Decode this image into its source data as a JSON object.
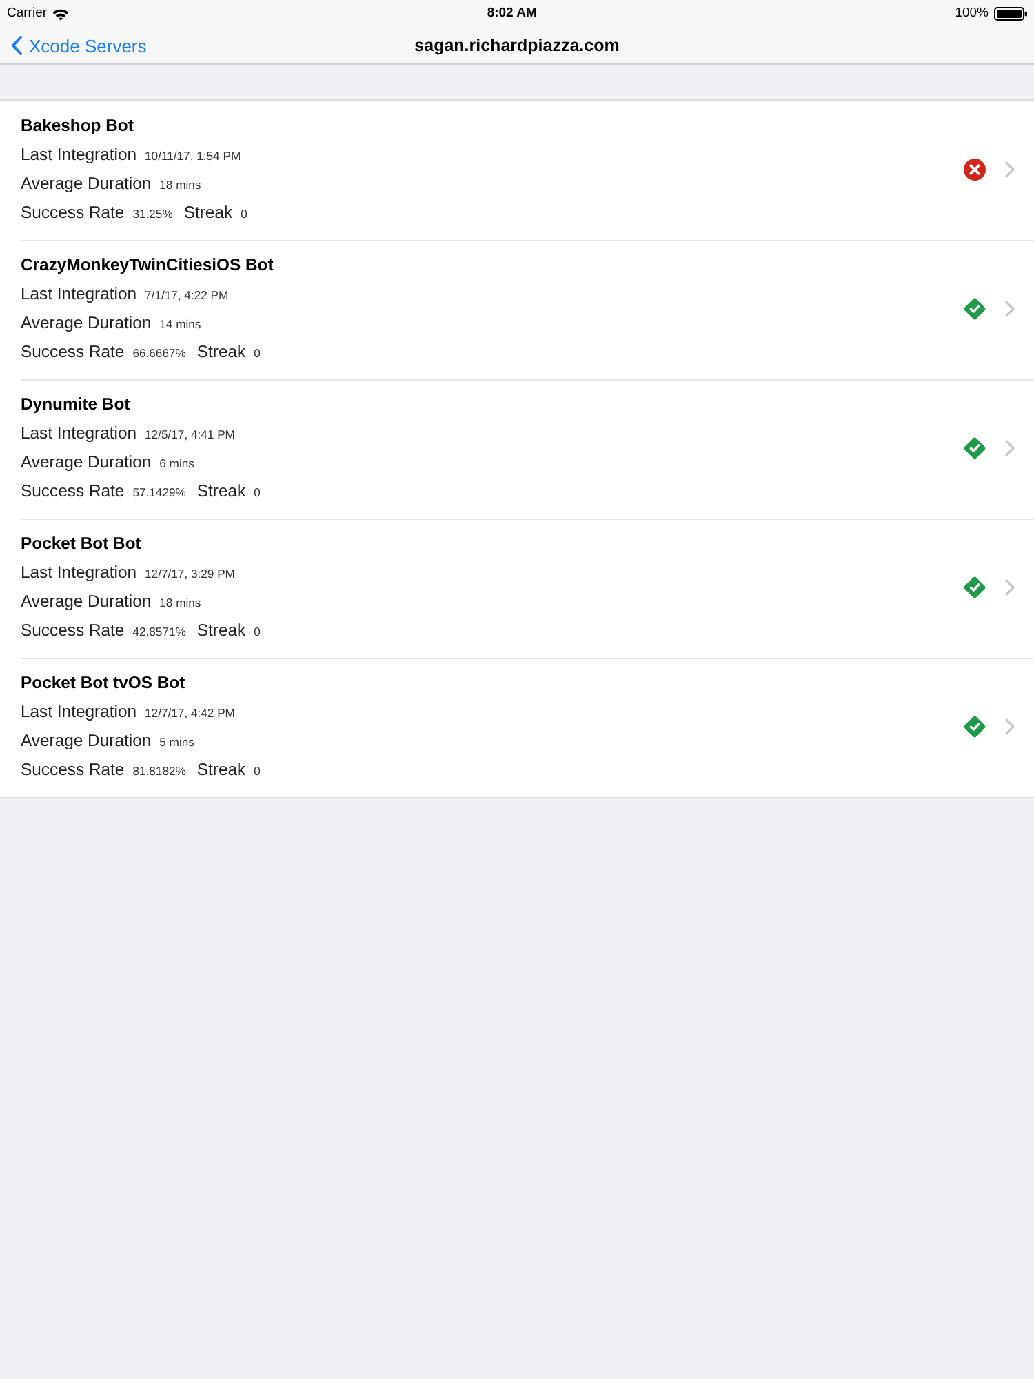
{
  "status_bar": {
    "carrier": "Carrier",
    "time": "8:02 AM",
    "battery": "100%"
  },
  "nav_bar": {
    "back": "Xcode Servers",
    "title": "sagan.richardpiazza.com"
  },
  "bots": [
    {
      "name": "Bakeshop Bot",
      "passed": false,
      "lines": [
        [
          {
            "label": "Last Integration",
            "value": "10/11/17, 1:54 PM"
          }
        ],
        [
          {
            "label": "Average Duration",
            "value": "18 mins"
          }
        ],
        [
          {
            "label": "Success Rate",
            "value": "31.25%"
          },
          {
            "label": "Streak",
            "value": "0"
          }
        ]
      ]
    },
    {
      "name": "CrazyMonkeyTwinCitiesiOS Bot",
      "passed": true,
      "lines": [
        [
          {
            "label": "Last Integration",
            "value": "7/1/17, 4:22 PM"
          }
        ],
        [
          {
            "label": "Average Duration",
            "value": "14 mins"
          }
        ],
        [
          {
            "label": "Success Rate",
            "value": "66.6667%"
          },
          {
            "label": "Streak",
            "value": "0"
          }
        ]
      ]
    },
    {
      "name": "Dynumite Bot",
      "passed": true,
      "lines": [
        [
          {
            "label": "Last Integration",
            "value": "12/5/17, 4:41 PM"
          }
        ],
        [
          {
            "label": "Average Duration",
            "value": "6 mins"
          }
        ],
        [
          {
            "label": "Success Rate",
            "value": "57.1429%"
          },
          {
            "label": "Streak",
            "value": "0"
          }
        ]
      ]
    },
    {
      "name": "Pocket Bot Bot",
      "passed": true,
      "lines": [
        [
          {
            "label": "Last Integration",
            "value": "12/7/17, 3:29 PM"
          }
        ],
        [
          {
            "label": "Average Duration",
            "value": "18 mins"
          }
        ],
        [
          {
            "label": "Success Rate",
            "value": "42.8571%"
          },
          {
            "label": "Streak",
            "value": "0"
          }
        ]
      ]
    },
    {
      "name": "Pocket Bot tvOS Bot",
      "passed": true,
      "lines": [
        [
          {
            "label": "Last Integration",
            "value": "12/7/17, 4:42 PM"
          }
        ],
        [
          {
            "label": "Average Duration",
            "value": "5 mins"
          }
        ],
        [
          {
            "label": "Success Rate",
            "value": "81.8182%"
          },
          {
            "label": "Streak",
            "value": "0"
          }
        ]
      ]
    }
  ]
}
